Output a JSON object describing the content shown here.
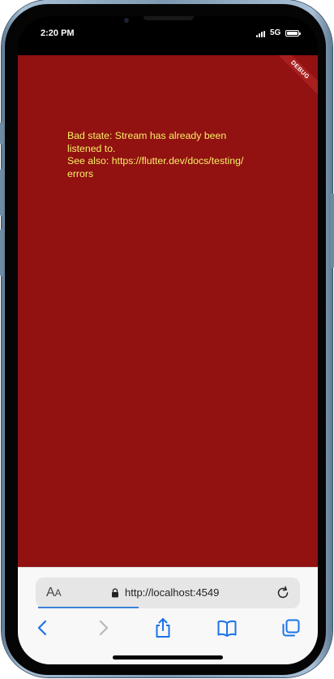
{
  "status_bar": {
    "time": "2:20 PM",
    "network": "5G"
  },
  "app": {
    "banner": "DEBUG",
    "error_message": "Bad state: Stream has already been\nlistened to.\nSee also: https://flutter.dev/docs/testing/\nerrors"
  },
  "browser": {
    "text_size_big": "A",
    "text_size_small": "A",
    "url": "http://localhost:4549",
    "load_progress": 0.38
  },
  "icons": {
    "back": "chevron-left-icon",
    "forward": "chevron-right-icon",
    "share": "share-icon",
    "bookmarks": "book-icon",
    "tabs": "tabs-icon",
    "lock": "lock-icon",
    "reload": "reload-icon"
  },
  "colors": {
    "error_background": "#921111",
    "error_text": "#f6ef65",
    "accent": "#3b82d8"
  }
}
